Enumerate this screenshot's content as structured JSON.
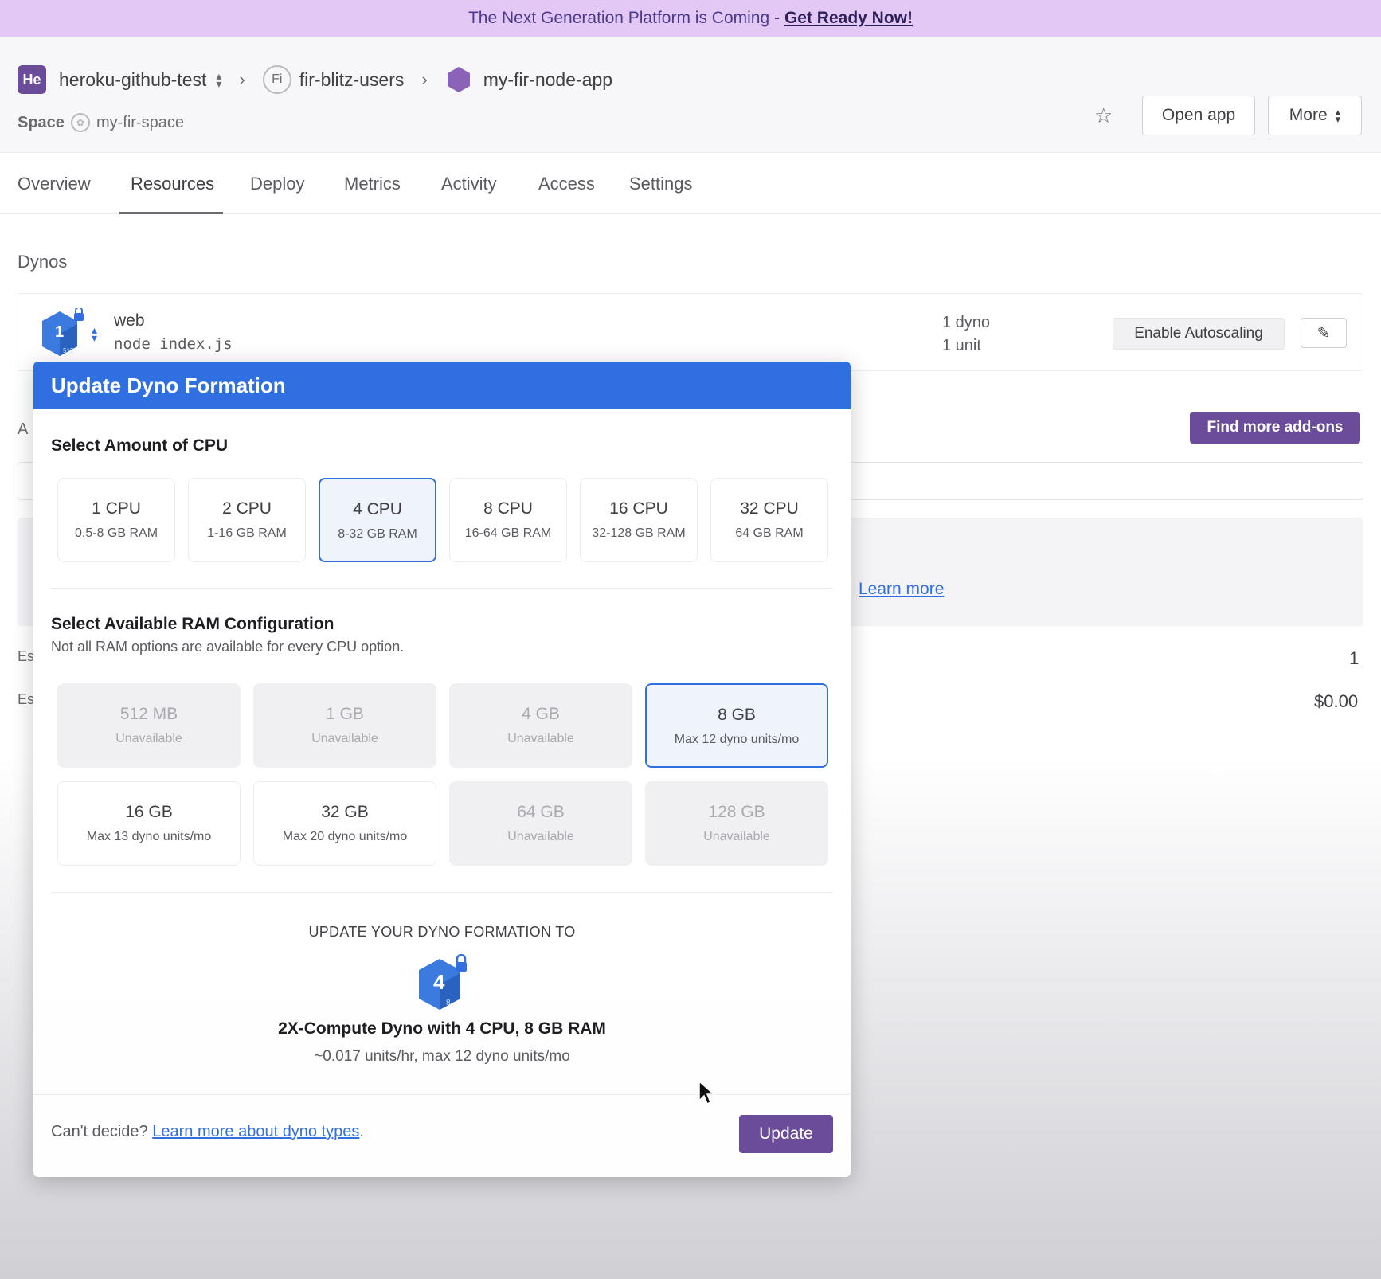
{
  "banner": {
    "text": "The Next Generation Platform is Coming - ",
    "link": "Get Ready Now!"
  },
  "header": {
    "team_badge": "He",
    "team": "heroku-github-test",
    "pipeline_badge": "Fi",
    "pipeline": "fir-blitz-users",
    "app": "my-fir-node-app",
    "space_label": "Space",
    "space": "my-fir-space",
    "open_app": "Open app",
    "more": "More"
  },
  "tabs": [
    "Overview",
    "Resources",
    "Deploy",
    "Metrics",
    "Activity",
    "Access",
    "Settings"
  ],
  "active_tab": "Resources",
  "dynos": {
    "section_title": "Dynos",
    "process": "web",
    "command": "node index.js",
    "icon_number": "1",
    "icon_ram": "512",
    "count": "1 dyno",
    "units": "1 unit",
    "enable_autoscaling": "Enable Autoscaling"
  },
  "background": {
    "addons_partial": "A",
    "find_addons": "Find more add-ons",
    "learn_more": "Learn more",
    "est1_partial": "Es",
    "est2_partial": "Es",
    "value1": "1",
    "value2": "$0.00"
  },
  "modal": {
    "title": "Update Dyno Formation",
    "cpu_heading": "Select Amount of CPU",
    "cpu_options": [
      {
        "title": "1 CPU",
        "sub": "0.5-8 GB RAM",
        "selected": false
      },
      {
        "title": "2 CPU",
        "sub": "1-16 GB RAM",
        "selected": false
      },
      {
        "title": "4 CPU",
        "sub": "8-32 GB RAM",
        "selected": true
      },
      {
        "title": "8 CPU",
        "sub": "16-64 GB RAM",
        "selected": false
      },
      {
        "title": "16 CPU",
        "sub": "32-128 GB RAM",
        "selected": false
      },
      {
        "title": "32 CPU",
        "sub": "64 GB RAM",
        "selected": false
      }
    ],
    "ram_heading": "Select Available RAM Configuration",
    "ram_note": "Not all RAM options are available for every CPU option.",
    "ram_options": [
      {
        "title": "512 MB",
        "sub": "Unavailable",
        "state": "unavailable"
      },
      {
        "title": "1 GB",
        "sub": "Unavailable",
        "state": "unavailable"
      },
      {
        "title": "4 GB",
        "sub": "Unavailable",
        "state": "unavailable"
      },
      {
        "title": "8 GB",
        "sub": "Max 12 dyno units/mo",
        "state": "selected"
      },
      {
        "title": "16 GB",
        "sub": "Max 13 dyno units/mo",
        "state": "available"
      },
      {
        "title": "32 GB",
        "sub": "Max 20 dyno units/mo",
        "state": "available"
      },
      {
        "title": "64 GB",
        "sub": "Unavailable",
        "state": "unavailable"
      },
      {
        "title": "128 GB",
        "sub": "Unavailable",
        "state": "unavailable"
      }
    ],
    "summary_heading": "UPDATE YOUR DYNO FORMATION TO",
    "summary_icon_number": "4",
    "summary_icon_ram": "8",
    "summary_title": "2X-Compute Dyno with 4 CPU, 8 GB RAM",
    "summary_sub": "~0.017 units/hr, max 12 dyno units/mo",
    "footer_prefix": "Can't decide? ",
    "footer_link": "Learn more about dyno types",
    "footer_suffix": ".",
    "update": "Update"
  },
  "colors": {
    "heroku_purple": "#6b4c9a",
    "modal_blue": "#2f6fe0",
    "banner_bg": "#e3c8f5"
  }
}
